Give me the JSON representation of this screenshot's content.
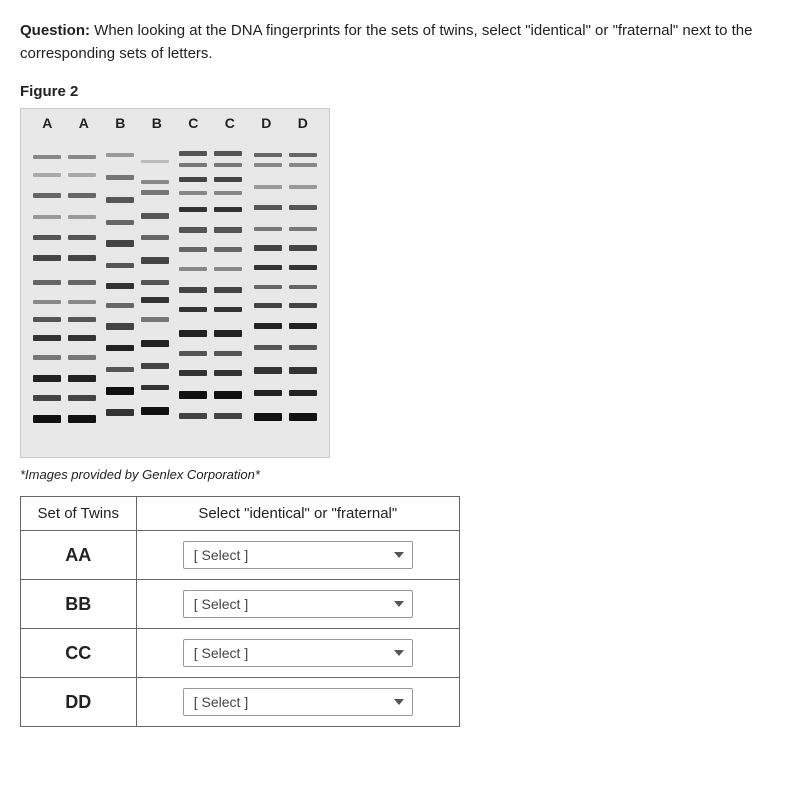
{
  "question": {
    "label": "Question:",
    "text": "When looking at the DNA fingerprints for the sets of twins, select \"identical\" or \"fraternal\" next to the corresponding sets of letters."
  },
  "figure": {
    "label": "Figure 2",
    "credit": "*Images provided by Genlex Corporation*"
  },
  "table": {
    "header_col1": "Set of Twins",
    "header_col2": "Select \"identical\" or \"fraternal\"",
    "rows": [
      {
        "id": "AA",
        "label": "AA",
        "default": "[ Select ]"
      },
      {
        "id": "BB",
        "label": "BB",
        "default": "[ Select ]"
      },
      {
        "id": "CC",
        "label": "CC",
        "default": "[ Select ]"
      },
      {
        "id": "DD",
        "label": "DD",
        "default": "[ Select ]"
      }
    ],
    "options": [
      {
        "value": "",
        "label": "[ Select ]"
      },
      {
        "value": "identical",
        "label": "identical"
      },
      {
        "value": "fraternal",
        "label": "fraternal"
      }
    ]
  }
}
